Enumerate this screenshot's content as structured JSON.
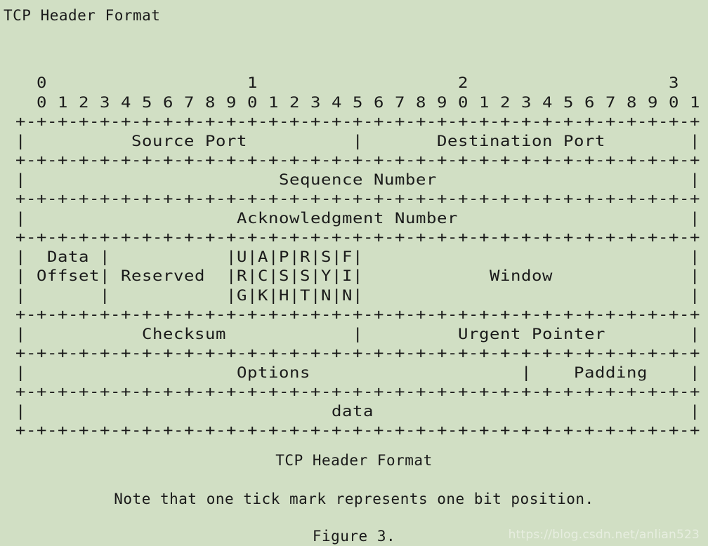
{
  "document": {
    "heading": "TCP Header Format",
    "background_color": "#d1dfc4",
    "text_color": "#1a1a1a"
  },
  "diagram": {
    "name": "tcp-header-format-ascii-diagram",
    "bit_scale_tens": "  0                   1                   2                   3",
    "bit_scale_ones": "  0 1 2 3 4 5 6 7 8 9 0 1 2 3 4 5 6 7 8 9 0 1 2 3 4 5 6 7 8 9 0 1",
    "lines": [
      "  0                   1                   2                   3",
      "  0 1 2 3 4 5 6 7 8 9 0 1 2 3 4 5 6 7 8 9 0 1 2 3 4 5 6 7 8 9 0 1",
      "+-+-+-+-+-+-+-+-+-+-+-+-+-+-+-+-+-+-+-+-+-+-+-+-+-+-+-+-+-+-+-+-+",
      "|          Source Port          |       Destination Port        |",
      "+-+-+-+-+-+-+-+-+-+-+-+-+-+-+-+-+-+-+-+-+-+-+-+-+-+-+-+-+-+-+-+-+",
      "|                        Sequence Number                        |",
      "+-+-+-+-+-+-+-+-+-+-+-+-+-+-+-+-+-+-+-+-+-+-+-+-+-+-+-+-+-+-+-+-+",
      "|                    Acknowledgment Number                      |",
      "+-+-+-+-+-+-+-+-+-+-+-+-+-+-+-+-+-+-+-+-+-+-+-+-+-+-+-+-+-+-+-+-+",
      "|  Data |           |U|A|P|R|S|F|                               |",
      "| Offset| Reserved  |R|C|S|S|Y|I|            Window             |",
      "|       |           |G|K|H|T|N|N|                               |",
      "+-+-+-+-+-+-+-+-+-+-+-+-+-+-+-+-+-+-+-+-+-+-+-+-+-+-+-+-+-+-+-+-+",
      "|           Checksum            |         Urgent Pointer        |",
      "+-+-+-+-+-+-+-+-+-+-+-+-+-+-+-+-+-+-+-+-+-+-+-+-+-+-+-+-+-+-+-+-+",
      "|                    Options                    |    Padding    |",
      "+-+-+-+-+-+-+-+-+-+-+-+-+-+-+-+-+-+-+-+-+-+-+-+-+-+-+-+-+-+-+-+-+",
      "|                             data                              |",
      "+-+-+-+-+-+-+-+-+-+-+-+-+-+-+-+-+-+-+-+-+-+-+-+-+-+-+-+-+-+-+-+-+"
    ],
    "fields": [
      {
        "label": "Source Port",
        "bits": 16
      },
      {
        "label": "Destination Port",
        "bits": 16
      },
      {
        "label": "Sequence Number",
        "bits": 32
      },
      {
        "label": "Acknowledgment Number",
        "bits": 32
      },
      {
        "label": "Data Offset",
        "bits": 4
      },
      {
        "label": "Reserved",
        "bits": 6
      },
      {
        "label": "URG",
        "bits": 1
      },
      {
        "label": "ACK",
        "bits": 1
      },
      {
        "label": "PSH",
        "bits": 1
      },
      {
        "label": "RST",
        "bits": 1
      },
      {
        "label": "SYN",
        "bits": 1
      },
      {
        "label": "FIN",
        "bits": 1
      },
      {
        "label": "Window",
        "bits": 16
      },
      {
        "label": "Checksum",
        "bits": 16
      },
      {
        "label": "Urgent Pointer",
        "bits": 16
      },
      {
        "label": "Options",
        "bits": 24
      },
      {
        "label": "Padding",
        "bits": 8
      },
      {
        "label": "data",
        "bits": 32
      }
    ]
  },
  "captions": {
    "figure_title": "TCP Header Format",
    "note": "Note that one tick mark represents one bit position.",
    "figure_number": "Figure 3."
  },
  "watermark": {
    "text": "https://blog.csdn.net/anlian523"
  }
}
